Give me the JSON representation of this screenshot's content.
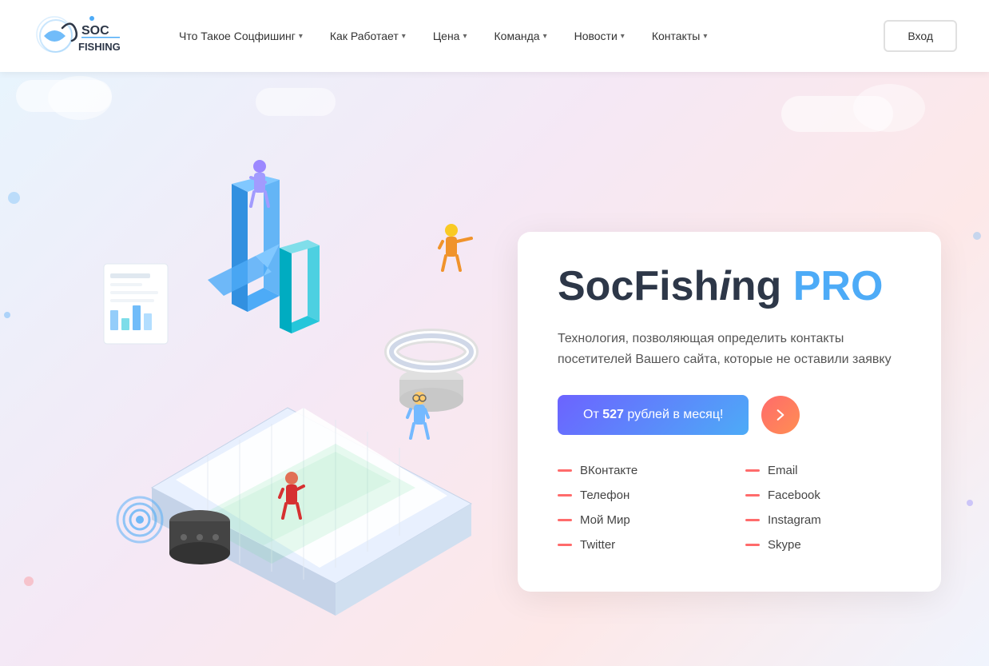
{
  "header": {
    "logo_text": "SOC FISHING",
    "nav": [
      {
        "label": "Что Такое Соцфишинг",
        "has_dropdown": true
      },
      {
        "label": "Как Работает",
        "has_dropdown": true
      },
      {
        "label": "Цена",
        "has_dropdown": true
      },
      {
        "label": "Команда",
        "has_dropdown": true
      },
      {
        "label": "Новости",
        "has_dropdown": true
      },
      {
        "label": "Контакты",
        "has_dropdown": true
      }
    ],
    "login_label": "Вход"
  },
  "hero": {
    "title_part1": "SocFish",
    "title_part2": "ing ",
    "title_pro": "PRO",
    "description": "Технология, позволяющая определить контакты посетителей Вашего сайта, которые не оставили заявку",
    "cta_label_prefix": "От ",
    "cta_price": "527",
    "cta_label_suffix": " рублей в месяц!",
    "features": [
      {
        "col": 1,
        "label": "ВКонтакте"
      },
      {
        "col": 2,
        "label": "Email"
      },
      {
        "col": 1,
        "label": "Телефон"
      },
      {
        "col": 2,
        "label": "Facebook"
      },
      {
        "col": 1,
        "label": "Мой Мир"
      },
      {
        "col": 2,
        "label": "Instagram"
      },
      {
        "col": 1,
        "label": "Twitter"
      },
      {
        "col": 2,
        "label": "Skype"
      }
    ]
  }
}
